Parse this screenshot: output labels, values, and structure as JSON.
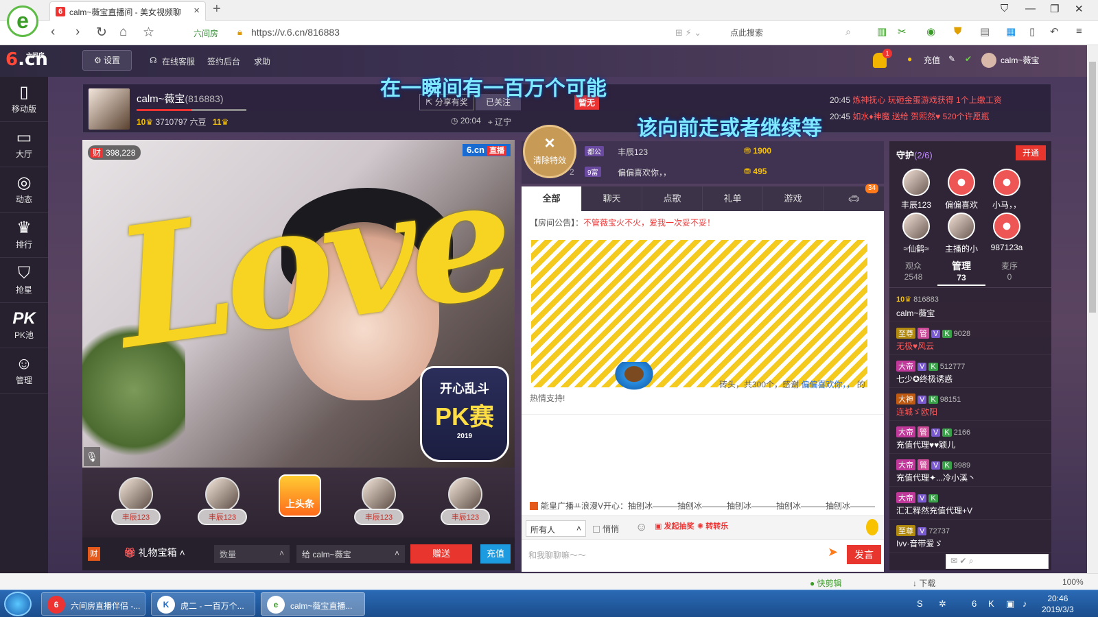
{
  "browser": {
    "tab_title": "calm~薇宝直播间 - 美女视频聊",
    "tab_fav": "6",
    "new_tab": "+",
    "url_tag": "六间房",
    "url": "https://v.6.cn/816883",
    "search_placeholder": "点此搜索"
  },
  "site": {
    "logo_num": "6",
    "logo_text": ".cn",
    "logo_sub": "六间房",
    "settings": "设置",
    "links": [
      "在线客服",
      "签约后台",
      "求助"
    ],
    "bell_count": "1",
    "recharge": "充值",
    "user": "calm~薇宝"
  },
  "lyrics": {
    "line1": "在一瞬间有一百万个可能",
    "line2": "该向前走或者继续等"
  },
  "sidebar": {
    "items": [
      {
        "label": "移动版",
        "icon": "mobile-icon"
      },
      {
        "label": "大厅",
        "icon": "tv-icon"
      },
      {
        "label": "动态",
        "icon": "compass-icon"
      },
      {
        "label": "排行",
        "icon": "crown-icon"
      },
      {
        "label": "抢星",
        "icon": "basket-icon"
      },
      {
        "label": "PK池",
        "icon": "pk-icon"
      },
      {
        "label": "管理",
        "icon": "admin-icon"
      }
    ]
  },
  "anchor": {
    "name": "calm~薇宝",
    "room_id": "(816883)",
    "level1": "10",
    "beans": "3710797 六豆",
    "level2": "11",
    "share": "分享有奖",
    "followed": "已关注",
    "time": "20:04",
    "location": "辽宁",
    "flag": "暂无",
    "progress": 0.5
  },
  "feed": [
    {
      "time": "20:45",
      "text": "炼神抚心 玩砸金蛋游戏获得 1个上缴工资"
    },
    {
      "time": "20:45",
      "text": "如水♦神魔 送给 贺熙然♥ 520个许愿瓶"
    }
  ],
  "video": {
    "viewers": "398,228",
    "badge_icon": "财",
    "logo": "6.cn",
    "logo_live": "直播",
    "overlay": "Love",
    "pk_line1": "开心乱斗",
    "pk_line2": "PK赛",
    "pk_year": "2019"
  },
  "clear_fx": "清除特效",
  "fans": {
    "tag": "丰辰123",
    "headline": "上头条"
  },
  "gift_bar": {
    "icon": "财",
    "box": "礼物宝箱",
    "qty": "数量",
    "to": "给 calm~薇宝",
    "send": "赠送",
    "recharge": "充值"
  },
  "rank_mini": [
    {
      "n": "1",
      "lv": "都公",
      "name": "丰辰123",
      "val": "1900"
    },
    {
      "n": "2",
      "lv": "9富",
      "name": "偏偏喜欢你，，",
      "val": "495"
    }
  ],
  "chat_tabs": [
    "全部",
    "聊天",
    "点歌",
    "礼单",
    "游戏"
  ],
  "car_badge": "34",
  "chat": {
    "notice_label": "【房间公告】：",
    "notice_text": "不管薇宝火不火，爱我一次妥不妥！",
    "brick_text_a": "砖头，共300个，感谢",
    "brick_user": "偏偏喜欢你，，",
    "brick_text_b": "的",
    "brick_text_c": "热情支持!",
    "broadcast": "能皇广播ㅛ浪漫V开心：抽刨冰———抽刨冰———抽刨冰———抽刨冰———抽刨冰———"
  },
  "chat_tools": {
    "target": "所有人",
    "whisper": "悄悄",
    "btn1": "发起抽奖",
    "btn2": "转转乐"
  },
  "chat_input": {
    "placeholder": "和我聊聊嘛～～",
    "send": "发言"
  },
  "guard": {
    "title": "守护",
    "count": "(2/6)",
    "open": "开通",
    "members": [
      "丰辰123",
      "偏偏喜欢",
      "小马，，",
      "≈仙鹤≈",
      "主播的小",
      "987123a"
    ]
  },
  "audience_tabs": [
    {
      "label": "观众",
      "count": "2548"
    },
    {
      "label": "管理",
      "count": "73"
    },
    {
      "label": "麦序",
      "count": "0"
    }
  ],
  "users": [
    {
      "lv": "10",
      "id": "816883",
      "name": "calm~薇宝",
      "red": false,
      "badges": []
    },
    {
      "lv": "",
      "id": "9028",
      "name": "无极♥风云",
      "red": true,
      "badges": [
        "至尊",
        "管",
        "V",
        "K"
      ]
    },
    {
      "lv": "",
      "id": "512777",
      "name": "七少✪终极诱惑",
      "red": false,
      "badges": [
        "大帝",
        "V",
        "K"
      ]
    },
    {
      "lv": "",
      "id": "98151",
      "name": "连城ゞ欧阳",
      "red": true,
      "badges": [
        "大神",
        "V",
        "K"
      ]
    },
    {
      "lv": "",
      "id": "2166",
      "name": "充值代理♥♥颖儿",
      "red": false,
      "badges": [
        "大帝",
        "管",
        "V",
        "K"
      ]
    },
    {
      "lv": "",
      "id": "9989",
      "name": "充值代理✦...冷小溪丶",
      "red": false,
      "badges": [
        "大帝",
        "管",
        "V",
        "K"
      ]
    },
    {
      "lv": "",
      "id": "",
      "name": "汇汇释然充值代理+V",
      "red": false,
      "badges": [
        "大帝",
        "V",
        "K"
      ]
    },
    {
      "lv": "",
      "id": "72737",
      "name": "Ivv·音带爱ゞ",
      "red": false,
      "badges": [
        "至尊",
        "V"
      ]
    }
  ],
  "statusbar": {
    "items": [
      "快剪辑",
      "下载",
      "100%"
    ]
  },
  "taskbar": {
    "tasks": [
      "六间房直播伴侣 -...",
      "虎二 - 一百万个...",
      "calm~薇宝直播..."
    ],
    "time": "20:46",
    "date": "2019/3/3"
  }
}
